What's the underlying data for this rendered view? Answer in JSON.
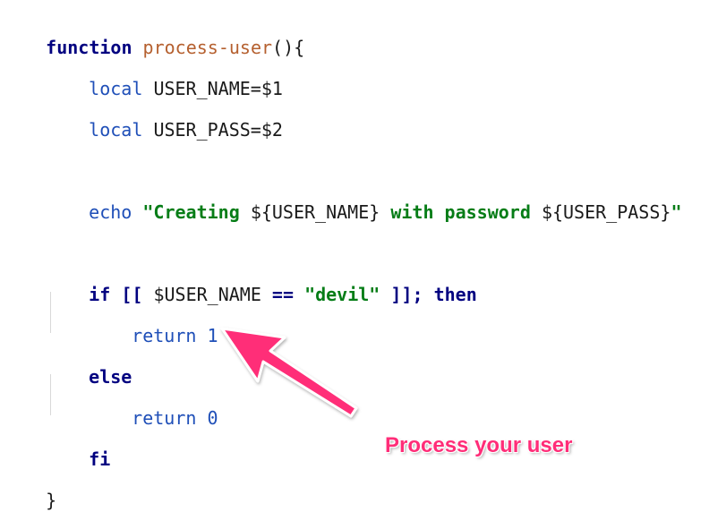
{
  "code": {
    "l1": {
      "kw": "function",
      "name": "process-user",
      "punc": "(){"
    },
    "l2": {
      "kw": "local",
      "rest": "USER_NAME=$1"
    },
    "l3": {
      "kw": "local",
      "rest": "USER_PASS=$2"
    },
    "l4": {
      "kw": "echo",
      "s1": "\"Creating ",
      "v1": "${USER_NAME}",
      "s2": " with password ",
      "v2": "${USER_PASS}",
      "s3": "\""
    },
    "l5": {
      "kw1": "if",
      "op1": "[[",
      "var": "$USER_NAME",
      "op2": "==",
      "str": "\"devil\"",
      "op3": "]];",
      "kw2": "then"
    },
    "l6": {
      "kw": "return",
      "num": "1"
    },
    "l7": {
      "kw": "else"
    },
    "l8": {
      "kw": "return",
      "num": "0"
    },
    "l9": {
      "kw": "fi"
    },
    "l10": {
      "punc": "}"
    }
  },
  "annotation": {
    "label": "Process your user",
    "color": "#ff2d78"
  },
  "colors": {
    "keyword": "#000080",
    "function_name": "#b5602f",
    "builtin": "#1f4fb8",
    "string": "#067d17",
    "number": "#1f4fb8"
  }
}
